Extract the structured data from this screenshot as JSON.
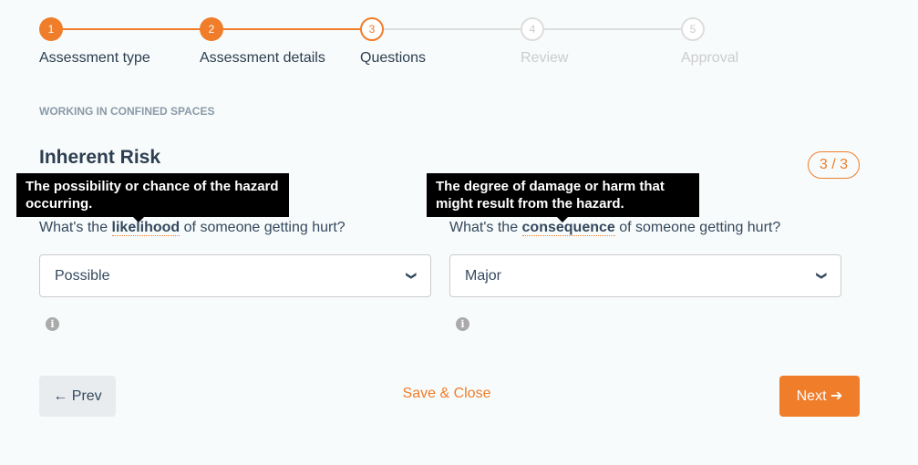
{
  "stepper": {
    "steps": [
      {
        "number": "1",
        "label": "Assessment type",
        "state": "done"
      },
      {
        "number": "2",
        "label": "Assessment details",
        "state": "done"
      },
      {
        "number": "3",
        "label": "Questions",
        "state": "current"
      },
      {
        "number": "4",
        "label": "Review",
        "state": "todo"
      },
      {
        "number": "5",
        "label": "Approval",
        "state": "todo"
      }
    ]
  },
  "section": {
    "subtitle": "WORKING IN CONFINED SPACES",
    "title": "Inherent Risk",
    "counter": "3 / 3"
  },
  "questions": [
    {
      "prefix": "What's the ",
      "term": "likelihood",
      "suffix": " of someone getting hurt?",
      "tooltip": "The possibility or chance of the hazard occurring.",
      "value": "Possible"
    },
    {
      "prefix": "What's the ",
      "term": "consequence",
      "suffix": " of someone getting hurt?",
      "tooltip": "The degree of damage or harm that might result from the hazard.",
      "value": "Major"
    }
  ],
  "footer": {
    "prev": "← Prev",
    "save": "Save & Close",
    "next": "Next ➔"
  },
  "colors": {
    "accent": "#ef7d2a",
    "text": "#2c3e50"
  }
}
